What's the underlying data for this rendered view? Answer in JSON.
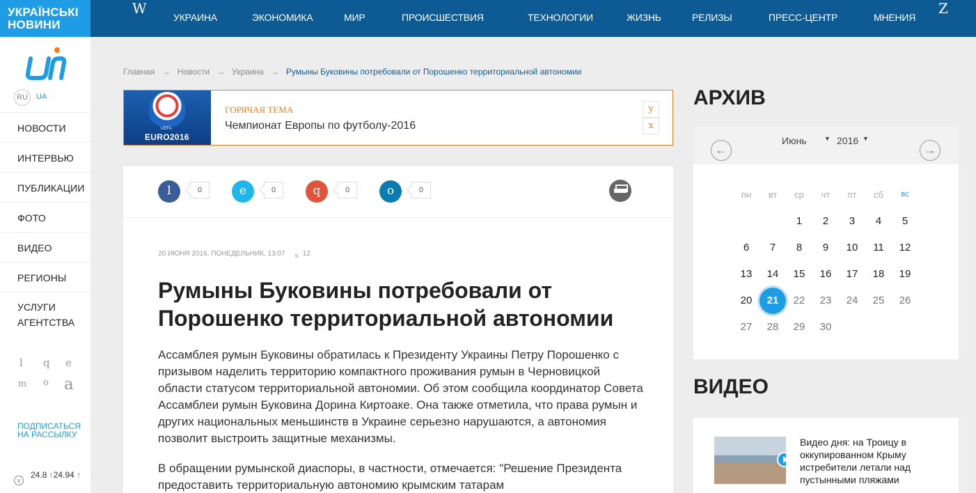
{
  "brand": {
    "line1": "УКРАЇНСЬКІ",
    "line2": "НОВИНИ"
  },
  "top_icons": {
    "left": "W",
    "right": "Z"
  },
  "nav": [
    "УКРАИНА",
    "ЭКОНОМИКА",
    "МИР",
    "ПРОИСШЕСТВИЯ",
    "ТЕХНОЛОГИИ",
    "ЖИЗНЬ",
    "РЕЛИЗЫ",
    "ПРЕСС-ЦЕНТР",
    "МНЕНИЯ"
  ],
  "lang": {
    "ru": "RU",
    "ua": "UA"
  },
  "sidebar_menu": [
    "НОВОСТИ",
    "ИНТЕРВЬЮ",
    "ПУБЛИКАЦИИ",
    "ФОТО",
    "ВИДЕО",
    "РЕГИОНЫ"
  ],
  "sidebar_menu_tall": {
    "line1": "УСЛУГИ",
    "line2": "АГЕНТСТВА"
  },
  "sidebar_social": [
    "l",
    "q",
    "e",
    "m",
    "o",
    "a"
  ],
  "subscribe": {
    "line1": "ПОДПИСАТЬСЯ",
    "line2": "НА РАССЫЛКУ"
  },
  "rate": {
    "icon": "v",
    "value1": "24.8",
    "value2": "24.94"
  },
  "breadcrumb": {
    "home": "Главная",
    "news": "Новости",
    "section": "Украина",
    "current": "Румыны Буковины потребовали от Порошенко территориальной автономии",
    "arrow": "→"
  },
  "hot": {
    "label": "ГОРЯЧАЯ ТЕМА",
    "title": "Чемпионат Европы по футболу-2016",
    "image_text": "EURO2016",
    "image_small": "UEFA",
    "btn_up": "y",
    "btn_close": "x"
  },
  "share": [
    {
      "glyph": "l",
      "count": "0",
      "color": "#3b5d97"
    },
    {
      "glyph": "e",
      "count": "0",
      "color": "#1fb6ec"
    },
    {
      "glyph": "q",
      "count": "0",
      "color": "#e0533d"
    },
    {
      "glyph": "o",
      "count": "0",
      "color": "#0a7cb1"
    }
  ],
  "article": {
    "meta_date": "20 ИЮНЯ 2016, ПОНЕДЕЛЬНИК, 13:07",
    "meta_eye": "s",
    "meta_views": "12",
    "title": "Румыны Буковины потребовали от Порошенко территориальной автономии",
    "lead": "Ассамблея румын Буковины обратилась к Президенту Украины Петру Порошенко с призывом наделить территорию компактного проживания румын в Черновицкой области статусом территориальной автономии. Об этом сообщила координатор Совета Ассамблеи румын Буковина Дорина Киртоаке. Она также отметила, что права румын и других национальных меньшинств в Украине серьезно нарушаются, а автономия позволит выстроить защитные механизмы.",
    "para2": "В обращении румынской диаспоры, в частности, отмечается: \"Решение Президента предоставить территориальную автономию крымским татарам"
  },
  "archive": {
    "heading": "АРХИВ",
    "month": "Июнь",
    "year": "2016",
    "caret": "▼",
    "prev": "←",
    "next": "→",
    "weekdays": [
      "пн",
      "вт",
      "ср",
      "чт",
      "пт",
      "сб",
      "вс"
    ],
    "weeks": [
      [
        "",
        "",
        "1",
        "2",
        "3",
        "4",
        "5"
      ],
      [
        "6",
        "7",
        "8",
        "9",
        "10",
        "11",
        "12"
      ],
      [
        "13",
        "14",
        "15",
        "16",
        "17",
        "18",
        "19"
      ],
      [
        "20",
        "21",
        "22",
        "23",
        "24",
        "25",
        "26"
      ],
      [
        "27",
        "28",
        "29",
        "30",
        "",
        "",
        ""
      ]
    ],
    "today": "21"
  },
  "video": {
    "heading": "ВИДЕО",
    "text": "Видео дня: на Троицу в оккупированном Крыму истребители летали над пустынными пляжами"
  }
}
